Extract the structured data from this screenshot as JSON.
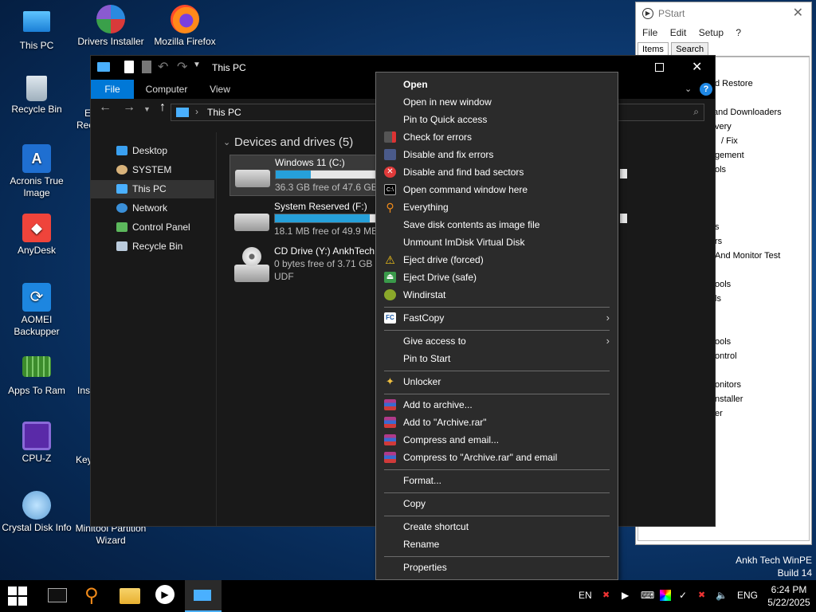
{
  "desktop": {
    "icons": [
      {
        "label": "This PC",
        "icon": "this-pc-icon"
      },
      {
        "label": "Drivers Installer",
        "icon": "drivers-installer-icon"
      },
      {
        "label": "Mozilla Firefox",
        "icon": "firefox-icon"
      },
      {
        "label": "Recycle Bin",
        "icon": "recycle-bin-icon"
      },
      {
        "label": "Acronis True Image",
        "icon": "acronis-icon"
      },
      {
        "label": "AnyDesk",
        "icon": "anydesk-icon"
      },
      {
        "label": "AOMEI Backupper",
        "icon": "aomei-icon"
      },
      {
        "label": "Apps To Ram",
        "icon": "ram-icon"
      },
      {
        "label": "CPU-Z",
        "icon": "cpuz-icon"
      },
      {
        "label": "Crystal Disk Info",
        "icon": "crystal-disk-icon"
      },
      {
        "label": "Minitool Partition Wizard",
        "icon": "minitool-icon"
      }
    ],
    "partial_labels": [
      "E",
      "Rec",
      "Ins",
      "Key"
    ],
    "watermark": {
      "line1": "Ankh Tech WinPE",
      "line2": "Build 14"
    }
  },
  "pstart": {
    "title": "PStart",
    "menu": [
      "File",
      "Edit",
      "Setup",
      "?"
    ],
    "tabs": [
      "Items",
      "Search"
    ],
    "item_fragments": [
      "d Restore",
      "and Downloaders",
      "very",
      "/ Fix",
      "gement",
      "ols",
      "s",
      "rs",
      "And Monitor Test",
      "ools",
      "ls",
      "ools",
      "ontrol",
      "onitors",
      "nstaller",
      "er"
    ]
  },
  "explorer": {
    "title": "This PC",
    "ribbon_tabs": [
      "File",
      "Computer",
      "View"
    ],
    "address": "This PC",
    "sidebar": [
      "Desktop",
      "SYSTEM",
      "This PC",
      "Network",
      "Control Panel",
      "Recycle Bin"
    ],
    "group_header": "Devices and drives (5)",
    "drives": [
      {
        "name": "Windows 11 (C:)",
        "free": "36.3 GB free of 47.6 GB",
        "used_fraction": 0.24
      },
      {
        "name": "System Reserved (F:)",
        "free": "18.1 MB free of 49.9 MB",
        "used_fraction": 0.64
      },
      {
        "name": "CD Drive (Y:) AnkhTech.",
        "free": "0 bytes free of 3.71 GB",
        "fs": "UDF"
      }
    ]
  },
  "context_menu": {
    "items": [
      {
        "label": "Open",
        "bold": true
      },
      {
        "label": "Open in new window"
      },
      {
        "label": "Pin to Quick access"
      },
      {
        "label": "Check for errors",
        "icon": "check-errors-icon"
      },
      {
        "label": "Disable and fix errors",
        "icon": "fix-errors-icon"
      },
      {
        "label": "Disable and find bad sectors",
        "icon": "bad-sectors-icon"
      },
      {
        "label": "Open command window here",
        "icon": "cmd-icon"
      },
      {
        "label": "Everything",
        "icon": "everything-search-icon"
      },
      {
        "label": "Save disk contents as image file"
      },
      {
        "label": "Unmount ImDisk Virtual Disk"
      },
      {
        "label": "Eject drive (forced)",
        "icon": "warning-icon"
      },
      {
        "label": "Eject Drive (safe)",
        "icon": "eject-safe-icon"
      },
      {
        "label": "Windirstat",
        "icon": "windirstat-icon"
      },
      {
        "label": "FastCopy",
        "icon": "fastcopy-icon",
        "submenu": true
      },
      {
        "label": "Give access to",
        "submenu": true
      },
      {
        "label": "Pin to Start"
      },
      {
        "label": "Unlocker",
        "icon": "unlocker-icon"
      },
      {
        "label": "Add to archive...",
        "icon": "winrar-icon"
      },
      {
        "label": "Add to \"Archive.rar\"",
        "icon": "winrar-icon"
      },
      {
        "label": "Compress and email...",
        "icon": "winrar-icon"
      },
      {
        "label": "Compress to \"Archive.rar\" and email",
        "icon": "winrar-icon"
      },
      {
        "label": "Format..."
      },
      {
        "label": "Copy"
      },
      {
        "label": "Create shortcut"
      },
      {
        "label": "Rename"
      },
      {
        "label": "Properties"
      }
    ]
  },
  "taskbar": {
    "lang_left": "EN",
    "lang_right": "ENG",
    "time": "6:24 PM",
    "date": "5/22/2025"
  },
  "colors": {
    "accent": "#0078d7",
    "progress": "#26a0da"
  }
}
